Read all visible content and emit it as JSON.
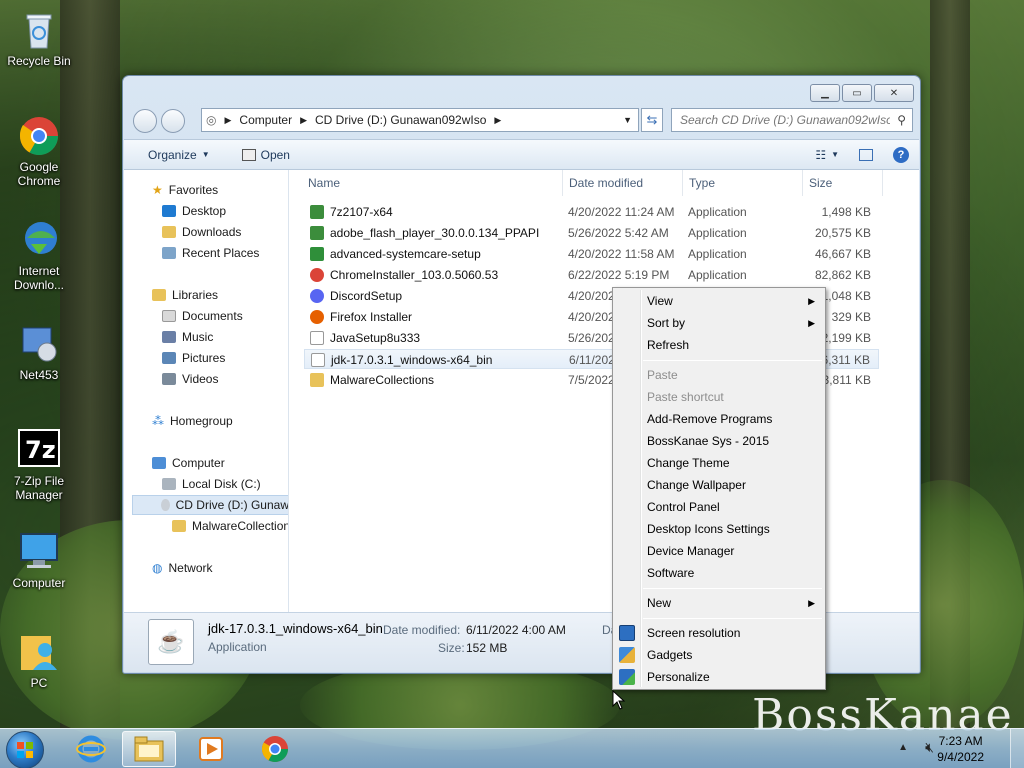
{
  "desktop": {
    "icons": [
      {
        "label": "Recycle Bin",
        "icon": "recycle-bin-icon"
      },
      {
        "label": "Google Chrome",
        "icon": "chrome-icon"
      },
      {
        "label": "Internet Downlo...",
        "icon": "internet-download-manager-icon"
      },
      {
        "label": "Net453",
        "icon": "net453-icon"
      },
      {
        "label": "7-Zip File Manager",
        "icon": "7zip-icon"
      },
      {
        "label": "Computer",
        "icon": "computer-icon"
      },
      {
        "label": "PC",
        "icon": "user-folder-icon"
      }
    ],
    "watermark": "BossKanae"
  },
  "explorer": {
    "address": {
      "segments": [
        "Computer",
        "CD Drive (D:) Gunawan092wIso"
      ]
    },
    "search_placeholder": "Search CD Drive (D:) Gunawan092wIso",
    "toolbar": {
      "organize": "Organize",
      "open": "Open"
    },
    "nav": {
      "favorites": "Favorites",
      "desktop": "Desktop",
      "downloads": "Downloads",
      "recent": "Recent Places",
      "libraries": "Libraries",
      "documents": "Documents",
      "music": "Music",
      "pictures": "Pictures",
      "videos": "Videos",
      "homegroup": "Homegroup",
      "computer": "Computer",
      "local_disk": "Local Disk (C:)",
      "cd_drive": "CD Drive (D:) Gunaw",
      "malware_collection": "MalwareCollection",
      "network": "Network"
    },
    "columns": {
      "name": "Name",
      "date": "Date modified",
      "type": "Type",
      "size": "Size"
    },
    "files": [
      {
        "name": "7z2107-x64",
        "date": "4/20/2022 11:24 AM",
        "type": "Application",
        "size": "1,498 KB",
        "color": "#3c8d3c"
      },
      {
        "name": "adobe_flash_player_30.0.0.134_PPAPI",
        "date": "5/26/2022 5:42 AM",
        "type": "Application",
        "size": "20,575 KB",
        "color": "#3c8d3c"
      },
      {
        "name": "advanced-systemcare-setup",
        "date": "4/20/2022 11:58 AM",
        "type": "Application",
        "size": "46,667 KB",
        "color": "#2f8f3a"
      },
      {
        "name": "ChromeInstaller_103.0.5060.53",
        "date": "6/22/2022 5:19 PM",
        "type": "Application",
        "size": "82,862 KB",
        "color": "#db4437"
      },
      {
        "name": "DiscordSetup",
        "date": "4/20/2022",
        "type": "",
        "size": "81,048 KB",
        "color": "#5865f2"
      },
      {
        "name": "Firefox Installer",
        "date": "4/20/2022",
        "type": "",
        "size": "329 KB",
        "color": "#e66000"
      },
      {
        "name": "JavaSetup8u333",
        "date": "5/26/2022",
        "type": "",
        "size": "2,199 KB",
        "color": "#c0392b"
      },
      {
        "name": "jdk-17.0.3.1_windows-x64_bin",
        "date": "6/11/2022",
        "type": "",
        "size": "156,311 KB",
        "color": "#c0392b"
      },
      {
        "name": "MalwareCollections",
        "date": "7/5/2022",
        "type": "",
        "size": "13,811 KB",
        "color": "#e8c25a"
      }
    ],
    "details": {
      "name": "jdk-17.0.3.1_windows-x64_bin",
      "type": "Application",
      "date_label": "Date modified:",
      "date_value": "6/11/2022 4:00 AM",
      "size_label": "Size:",
      "size_value": "152 MB",
      "date_created_partial": "Da"
    }
  },
  "context_menu": {
    "items": [
      {
        "label": "View",
        "submenu": true
      },
      {
        "label": "Sort by",
        "submenu": true
      },
      {
        "label": "Refresh"
      },
      {
        "label": "Paste",
        "disabled": true
      },
      {
        "label": "Paste shortcut",
        "disabled": true
      },
      {
        "label": "Add-Remove Programs"
      },
      {
        "label": "BossKanae Sys - 2015"
      },
      {
        "label": "Change Theme"
      },
      {
        "label": "Change Wallpaper"
      },
      {
        "label": "Control Panel"
      },
      {
        "label": "Desktop Icons Settings"
      },
      {
        "label": "Device Manager"
      },
      {
        "label": "Software"
      },
      {
        "label": "New",
        "submenu": true
      },
      {
        "label": "Screen resolution",
        "icon": "display-icon"
      },
      {
        "label": "Gadgets",
        "icon": "gadgets-icon"
      },
      {
        "label": "Personalize",
        "icon": "personalize-icon"
      }
    ]
  },
  "taskbar": {
    "time": "7:23 AM",
    "date": "9/4/2022"
  }
}
